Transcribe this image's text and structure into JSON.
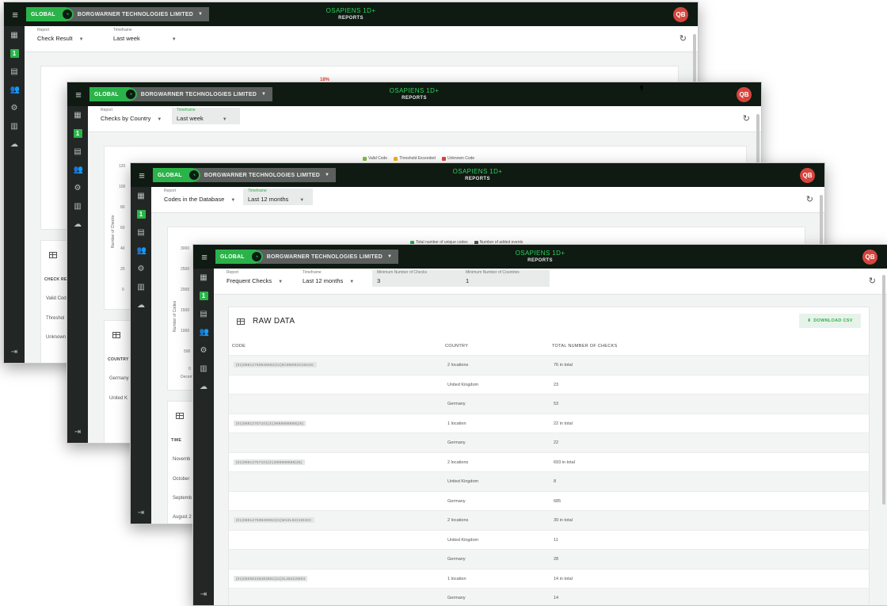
{
  "common": {
    "global_label": "GLOBAL",
    "company": "BORGWARNER TECHNOLOGIES LIMITED",
    "brand_line1": "OSAPIENS 1D+",
    "brand_line2": "REPORTS",
    "avatar": "QB",
    "report_label": "Report",
    "timeframe_label": "Timeframe"
  },
  "windows": [
    {
      "report": "Check Result",
      "timeframe": "Last week",
      "chart_pct_label": "18%",
      "table_peek": {
        "header": "CHECK RE",
        "rows": [
          "Valid Cod",
          "Threshol",
          "Unknown"
        ]
      }
    },
    {
      "report": "Checks by Country",
      "timeframe": "Last week",
      "legend": [
        {
          "label": "Valid Code",
          "color": "#7cc043"
        },
        {
          "label": "Threshold Exceeded",
          "color": "#f2b21b"
        },
        {
          "label": "Unknown Code",
          "color": "#d84a3c"
        }
      ],
      "y_ticks": [
        "120",
        "100",
        "80",
        "60",
        "40",
        "20",
        "0"
      ],
      "y_label": "Number of Checks",
      "table_peek": {
        "header": "COUNTRY",
        "rows": [
          "Germany",
          "United K"
        ]
      }
    },
    {
      "report": "Codes in the Database",
      "timeframe": "Last 12 months",
      "legend": [
        {
          "label": "Total number of unique codes",
          "color": "#2bb34a"
        },
        {
          "label": "Number of added events",
          "color": "#555555"
        }
      ],
      "y_ticks": [
        "3000",
        "2500",
        "2000",
        "1500",
        "1000",
        "500",
        "0"
      ],
      "y_label": "Number of Codes",
      "x_peek": "Decem",
      "table_peek": {
        "header": "TIME",
        "rows": [
          "Novemb",
          "October",
          "Septemb",
          "August 2"
        ]
      }
    },
    {
      "report": "Frequent Checks",
      "timeframe": "Last 12 months",
      "min_checks_label": "Minimum Number of Checks",
      "min_checks": "3",
      "min_countries_label": "Minimum Number of Countries",
      "min_countries": "1",
      "raw_title": "RAW DATA",
      "download_label": "DOWNLOAD CSV",
      "columns": [
        "CODE",
        "COUNTRY",
        "TOTAL NUMBER OF CHECKS"
      ],
      "rows": [
        {
          "code": "(01)08812759948082(21)9C9M09221W42C",
          "country": "2 locations",
          "total": "76 in total"
        },
        {
          "code": "",
          "country": "United Kingdom",
          "total": "23"
        },
        {
          "code": "",
          "country": "Germany",
          "total": "53"
        },
        {
          "code": "(01)08812757101(21)W88888888(25)",
          "country": "1 location",
          "total": "22 in total"
        },
        {
          "code": "",
          "country": "Germany",
          "total": "22"
        },
        {
          "code": "(01)08812757101(21)888888888(25)",
          "country": "2 locations",
          "total": "693 in total"
        },
        {
          "code": "",
          "country": "United Kingdom",
          "total": "8"
        },
        {
          "code": "",
          "country": "Germany",
          "total": "685"
        },
        {
          "code": "(01)08812759948082(21)W43L9221W42C",
          "country": "2 locations",
          "total": "39 in total"
        },
        {
          "code": "",
          "country": "United Kingdom",
          "total": "11"
        },
        {
          "code": "",
          "country": "Germany",
          "total": "28"
        },
        {
          "code": "(01)05058108483951(21)3L49222W03",
          "country": "1 location",
          "total": "14 in total"
        },
        {
          "code": "",
          "country": "Germany",
          "total": "14"
        }
      ]
    }
  ]
}
